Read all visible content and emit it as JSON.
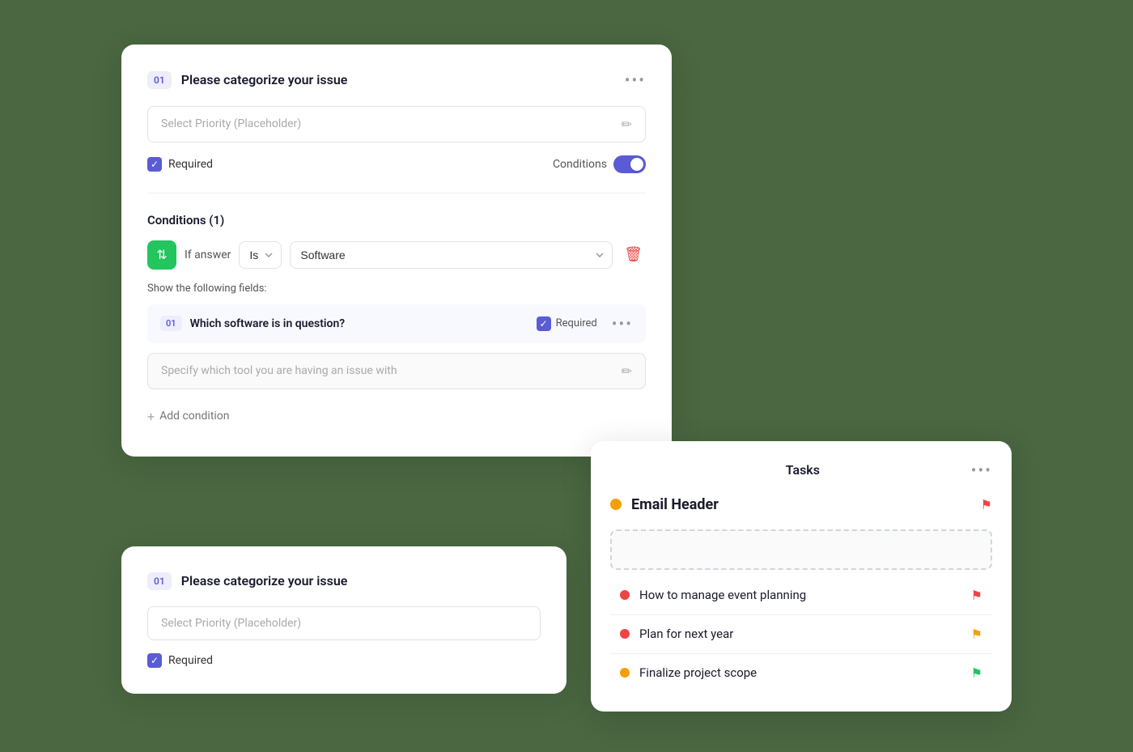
{
  "form": {
    "section1": {
      "step_badge": "01",
      "title": "Please categorize your issue",
      "more_dots": "•••",
      "placeholder_field": "Select Priority (Placeholder)",
      "required_label": "Required",
      "conditions_label": "Conditions"
    },
    "conditions_block": {
      "title": "Conditions (1)",
      "if_answer_label": "If answer",
      "is_select_value": "Is",
      "software_select_value": "Software",
      "show_fields_label": "Show the following fields:",
      "sub_step": "01",
      "sub_question": "Which software is in question?",
      "sub_required": "Required",
      "sub_placeholder": "Specify which tool you are having an issue with",
      "add_condition_label": "Add condition"
    }
  },
  "form2": {
    "step_badge": "01",
    "title": "Please categorize your issue",
    "placeholder_field": "Select Priority (Placeholder)",
    "required_label": "Required"
  },
  "tasks_panel": {
    "title": "Tasks",
    "more_dots": "•••",
    "email_header_label": "Email Header",
    "tasks": [
      {
        "id": 1,
        "text": "How to manage event planning",
        "dot_color": "red",
        "flag_color": "red"
      },
      {
        "id": 2,
        "text": "Plan for next year",
        "dot_color": "red",
        "flag_color": "yellow"
      },
      {
        "id": 3,
        "text": "Finalize project scope",
        "dot_color": "yellow",
        "flag_color": "green"
      }
    ]
  },
  "icons": {
    "edit_pencil": "✏",
    "delete_trash": "🗑",
    "filter_icon": "⇅",
    "flag_red": "⚑",
    "flag_yellow": "⚑",
    "flag_green": "⚑",
    "checkmark": "✓",
    "plus": "+"
  }
}
